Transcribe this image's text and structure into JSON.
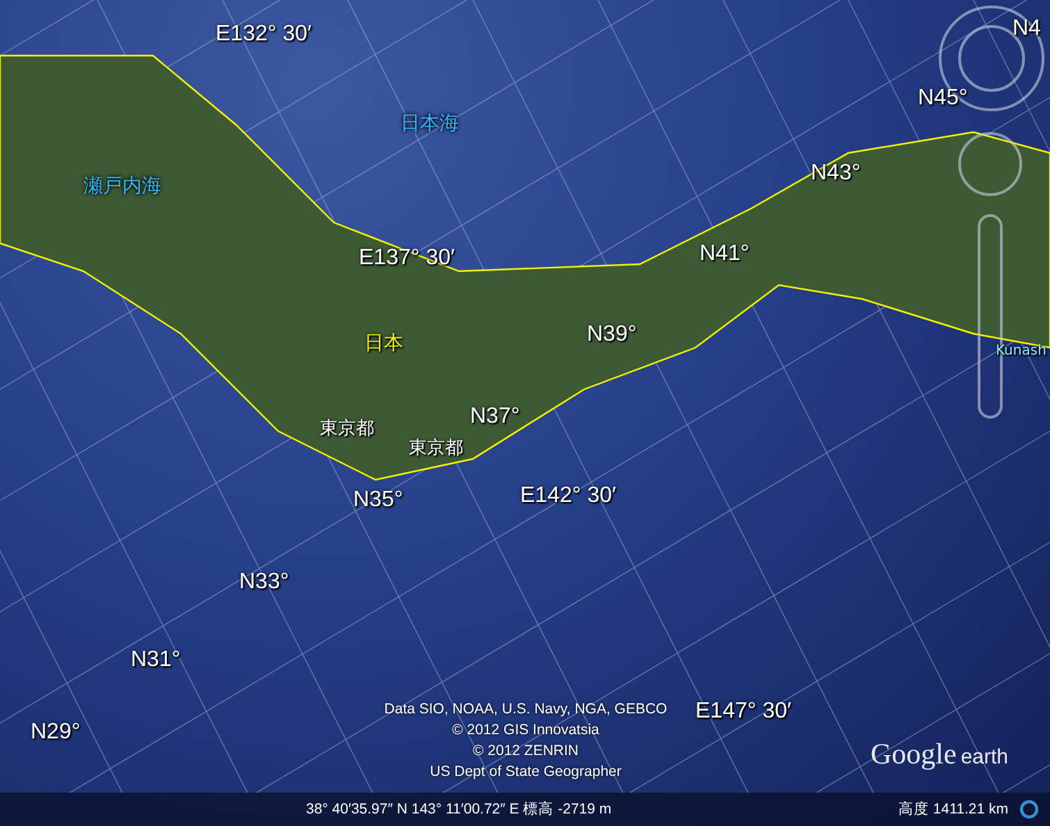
{
  "map": {
    "labels": [
      {
        "kind": "grid",
        "text": "E132°  30′"
      },
      {
        "kind": "sea",
        "text": "日本海"
      },
      {
        "kind": "grid",
        "text": "N45°"
      },
      {
        "kind": "grid",
        "text": "N4"
      },
      {
        "kind": "sea",
        "text": "瀬戸内海"
      },
      {
        "kind": "grid",
        "text": "N43°"
      },
      {
        "kind": "grid",
        "text": "E137°  30′"
      },
      {
        "kind": "grid",
        "text": "N41°"
      },
      {
        "kind": "country",
        "text": "日本"
      },
      {
        "kind": "grid",
        "text": "N39°"
      },
      {
        "kind": "island",
        "text": "Kunash"
      },
      {
        "kind": "city",
        "text": "東京都"
      },
      {
        "kind": "city",
        "text": "東京都"
      },
      {
        "kind": "grid",
        "text": "N37°"
      },
      {
        "kind": "grid",
        "text": "N35°"
      },
      {
        "kind": "grid",
        "text": "E142°  30′"
      },
      {
        "kind": "grid",
        "text": "N33°"
      },
      {
        "kind": "grid",
        "text": "N31°"
      },
      {
        "kind": "grid",
        "text": "E147°  30′"
      },
      {
        "kind": "grid",
        "text": "N29°"
      }
    ],
    "attribution": [
      "Data SIO, NOAA, U.S. Navy, NGA, GEBCO",
      "© 2012 GIS Innovatsia",
      "© 2012 ZENRIN",
      "US Dept of State Geographer"
    ],
    "logo": {
      "brand": "Google",
      "product": "earth"
    }
  },
  "status_bar": {
    "pointer": "38°  40′35.97″ N 143°  11′00.72″ E 標高 -2719 m",
    "altitude": "高度  1411.21 km"
  }
}
